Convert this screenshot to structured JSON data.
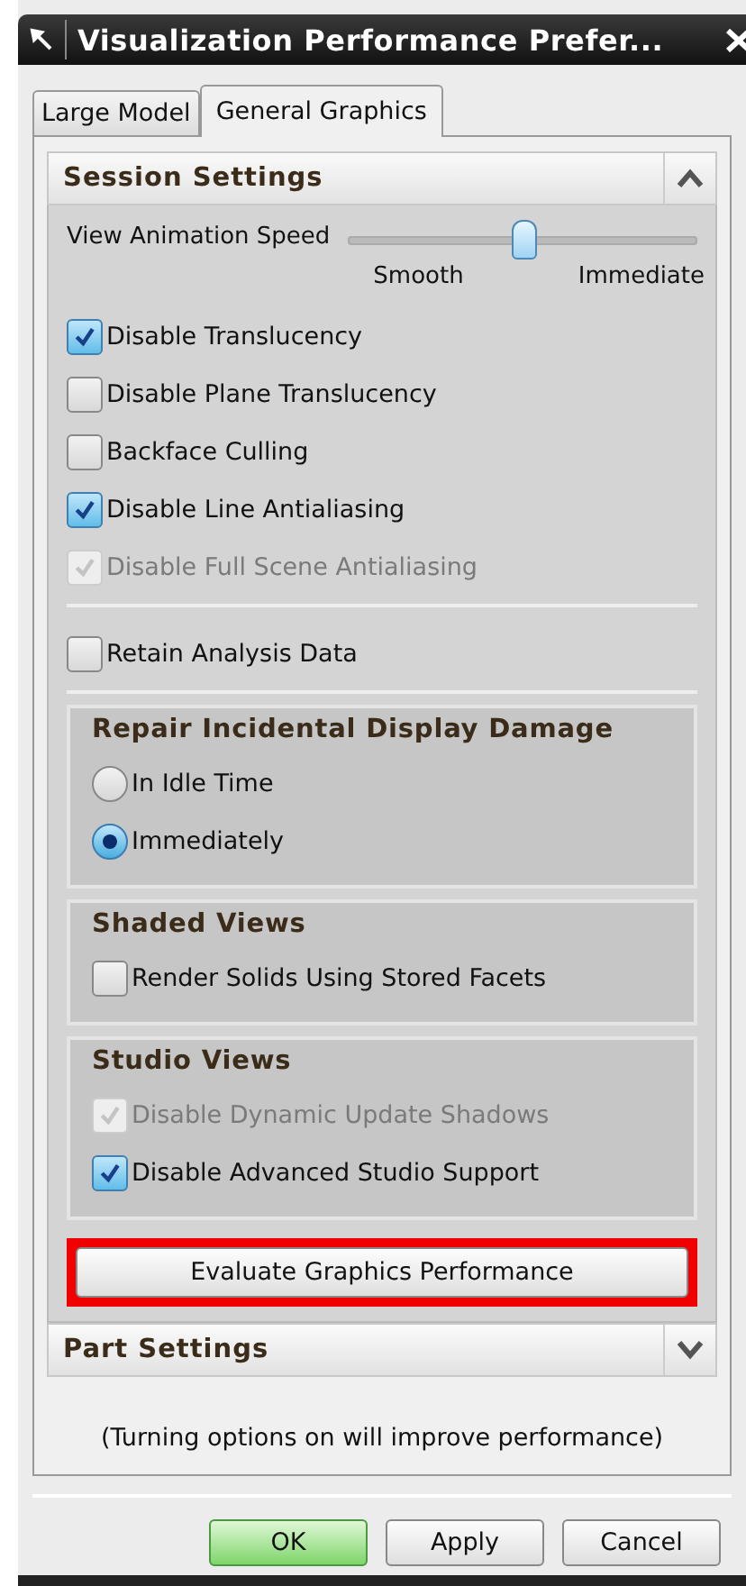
{
  "window": {
    "title": "Visualization Performance Prefer..."
  },
  "tabs": [
    {
      "label": "Large Model",
      "selected": false
    },
    {
      "label": "General Graphics",
      "selected": true
    }
  ],
  "session": {
    "title": "Session Settings",
    "expanded": true,
    "slider": {
      "label": "View Animation Speed",
      "level": 0.5,
      "min_label": "Smooth",
      "max_label": "Immediate"
    },
    "checkboxes": [
      {
        "label": "Disable Translucency",
        "checked": true,
        "disabled": false
      },
      {
        "label": "Disable Plane Translucency",
        "checked": false,
        "disabled": false
      },
      {
        "label": "Backface Culling",
        "checked": false,
        "disabled": false
      },
      {
        "label": "Disable Line Antialiasing",
        "checked": true,
        "disabled": false
      },
      {
        "label": "Disable Full Scene Antialiasing",
        "checked": true,
        "disabled": true
      }
    ],
    "extra_checkboxes": [
      {
        "label": "Retain Analysis Data",
        "checked": false,
        "disabled": false
      }
    ],
    "groups": [
      {
        "title": "Repair Incidental Display Damage",
        "items": [
          {
            "kind": "radio",
            "label": "In Idle Time",
            "selected": false
          },
          {
            "kind": "radio",
            "label": "Immediately",
            "selected": true
          }
        ]
      },
      {
        "title": "Shaded Views",
        "items": [
          {
            "kind": "checkbox",
            "label": "Render Solids Using Stored Facets",
            "checked": false,
            "disabled": false
          }
        ]
      },
      {
        "title": "Studio Views",
        "items": [
          {
            "kind": "checkbox",
            "label": "Disable Dynamic Update Shadows",
            "checked": true,
            "disabled": true
          },
          {
            "kind": "checkbox",
            "label": "Disable Advanced Studio Support",
            "checked": true,
            "disabled": false
          }
        ]
      }
    ],
    "action": {
      "label": "Evaluate Graphics Performance",
      "highlighted": true
    }
  },
  "part_settings": {
    "title": "Part Settings",
    "expanded": false
  },
  "note": "(Turning options on will improve performance)",
  "buttons": [
    {
      "label": "OK",
      "default": true
    },
    {
      "label": "Apply",
      "default": false
    },
    {
      "label": "Cancel",
      "default": false
    }
  ]
}
